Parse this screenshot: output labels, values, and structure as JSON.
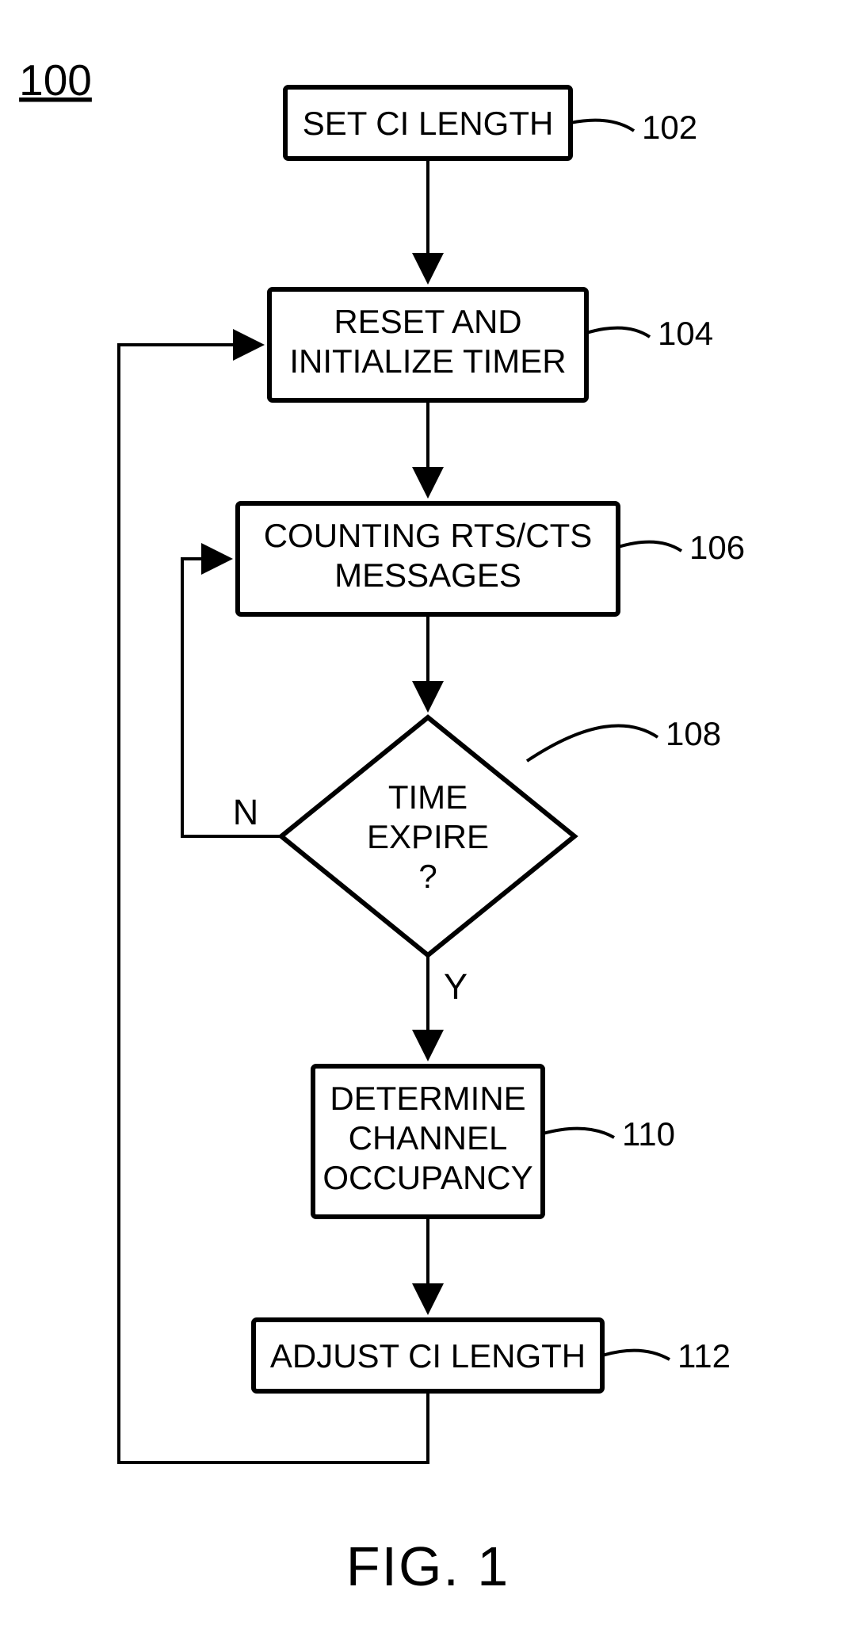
{
  "figure_ref": "100",
  "figure_label": "FIG. 1",
  "nodes": {
    "n102": {
      "lines": [
        "SET CI LENGTH"
      ],
      "ref": "102"
    },
    "n104": {
      "lines": [
        "RESET AND",
        "INITIALIZE TIMER"
      ],
      "ref": "104"
    },
    "n106": {
      "lines": [
        "COUNTING RTS/CTS",
        "MESSAGES"
      ],
      "ref": "106"
    },
    "n108": {
      "lines": [
        "TIME",
        "EXPIRE",
        "?"
      ],
      "ref": "108"
    },
    "n110": {
      "lines": [
        "DETERMINE",
        "CHANNEL",
        "OCCUPANCY"
      ],
      "ref": "110"
    },
    "n112": {
      "lines": [
        "ADJUST CI LENGTH"
      ],
      "ref": "112"
    }
  },
  "paths": {
    "yes": "Y",
    "no": "N"
  }
}
